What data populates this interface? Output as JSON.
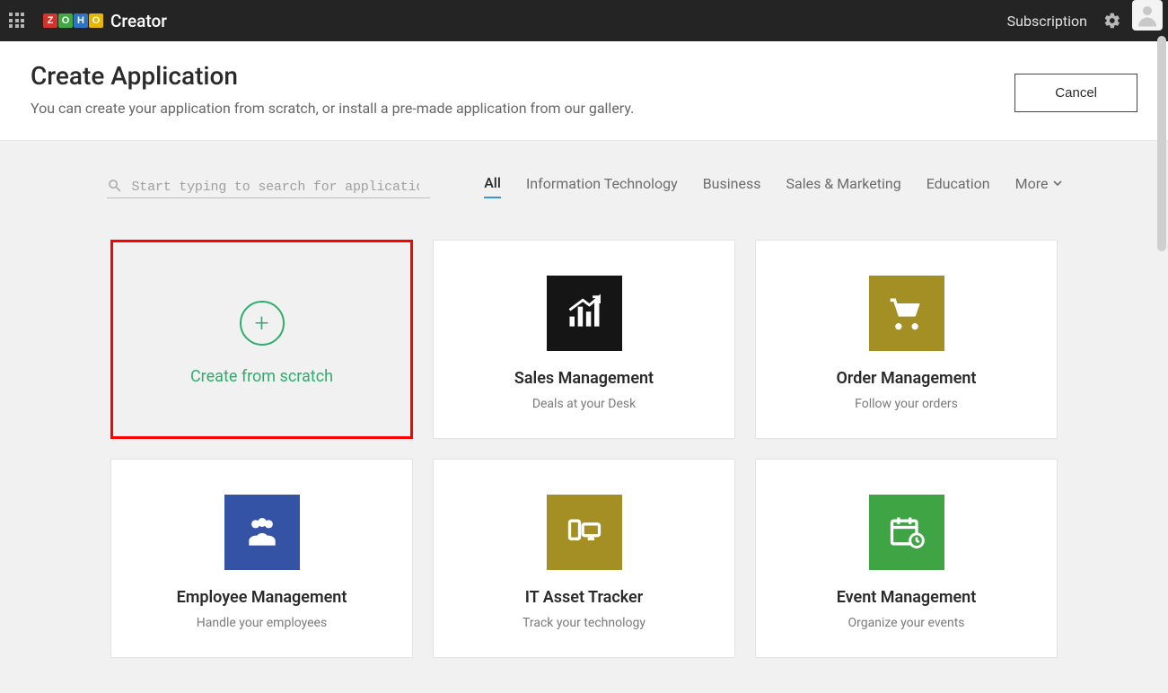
{
  "topbar": {
    "logo_text": "Creator",
    "subscription": "Subscription"
  },
  "header": {
    "title": "Create Application",
    "subtitle": "You can create your application from scratch, or install a pre-made application from our gallery.",
    "cancel": "Cancel"
  },
  "search": {
    "placeholder": "Start typing to search for applications…"
  },
  "categories": {
    "items": [
      {
        "label": "All",
        "active": true
      },
      {
        "label": "Information Technology",
        "active": false
      },
      {
        "label": "Business",
        "active": false
      },
      {
        "label": "Sales & Marketing",
        "active": false
      },
      {
        "label": "Education",
        "active": false
      }
    ],
    "more": "More"
  },
  "cards": {
    "create_label": "Create from scratch",
    "apps": [
      {
        "title": "Sales Management",
        "subtitle": "Deals at your Desk",
        "icon": "chart-arrow",
        "color": "black"
      },
      {
        "title": "Order Management",
        "subtitle": "Follow your orders",
        "icon": "cart",
        "color": "olive"
      },
      {
        "title": "Employee Management",
        "subtitle": "Handle your employees",
        "icon": "people",
        "color": "blue"
      },
      {
        "title": "IT Asset Tracker",
        "subtitle": "Track your technology",
        "icon": "computer",
        "color": "olive"
      },
      {
        "title": "Event Management",
        "subtitle": "Organize your events",
        "icon": "calendar-clock",
        "color": "green"
      }
    ]
  }
}
